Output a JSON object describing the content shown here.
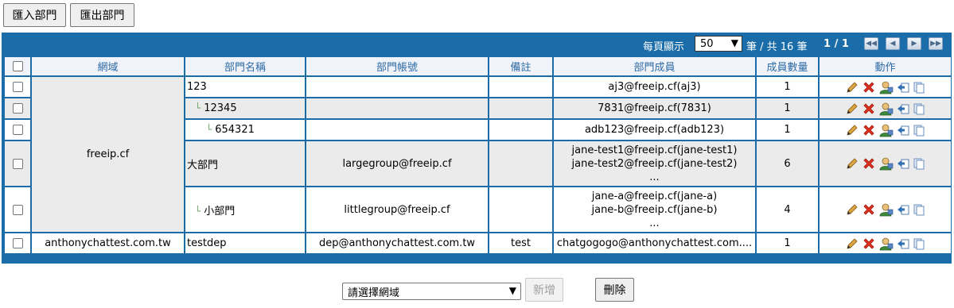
{
  "toolbar": {
    "import_label": "匯入部門",
    "export_label": "匯出部門"
  },
  "pager": {
    "per_page_label": "每頁顯示",
    "per_page_value": "50",
    "total_label": "筆 / 共 16 筆",
    "page_label": "1 / 1"
  },
  "table": {
    "headers": [
      "網域",
      "部門名稱",
      "部門帳號",
      "備註",
      "部門成員",
      "成員數量",
      "動作"
    ],
    "rows": [
      {
        "domain": "freeip.cf",
        "name": "123",
        "account": "",
        "note": "",
        "members": [
          "aj3@freeip.cf(aj3)"
        ],
        "count": "1"
      },
      {
        "domain": "",
        "name": "12345",
        "account": "",
        "note": "",
        "members": [
          "7831@freeip.cf(7831)"
        ],
        "count": "1"
      },
      {
        "domain": "",
        "name": "654321",
        "account": "",
        "note": "",
        "members": [
          "adb123@freeip.cf(adb123)"
        ],
        "count": "1"
      },
      {
        "domain": "",
        "name": "大部門",
        "account": "largegroup@freeip.cf",
        "note": "",
        "members": [
          "jane-test1@freeip.cf(jane-test1)",
          "jane-test2@freeip.cf(jane-test2)",
          "..."
        ],
        "count": "6"
      },
      {
        "domain": "",
        "name": "小部門",
        "account": "littlegroup@freeip.cf",
        "note": "",
        "members": [
          "jane-a@freeip.cf(jane-a)",
          "jane-b@freeip.cf(jane-b)",
          "..."
        ],
        "count": "4"
      },
      {
        "domain": "anthonychattest.com.tw",
        "name": "testdep",
        "account": "dep@anthonychattest.com.tw",
        "note": "test",
        "members": [
          "chatgogogo@anthonychattest.com...."
        ],
        "count": "1"
      }
    ],
    "tree_marker": "└"
  },
  "footer": {
    "domain_select_value": "請選擇網域",
    "add_label": "新增",
    "delete_label": "刪除"
  },
  "colors": {
    "header_bar": "#1a6da8",
    "header_cell": "#f0f4fa",
    "header_text": "#2e6aa4",
    "row_alt": "#ebebeb"
  },
  "icons": [
    "pencil-edit-icon",
    "red-x-delete-icon",
    "user-manage-icon",
    "export-arrow-icon",
    "copy-pages-icon"
  ]
}
